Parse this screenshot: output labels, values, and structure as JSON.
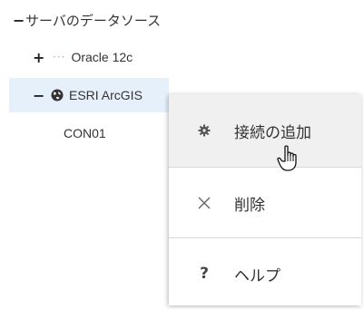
{
  "tree": {
    "root": {
      "toggle": "−",
      "label": "サーバのデータソース"
    },
    "items": [
      {
        "toggle": "+",
        "dots": "···",
        "label": "Oracle 12c"
      },
      {
        "toggle": "−",
        "icon": "globe-icon",
        "label": "ESRI ArcGIS"
      },
      {
        "label": "CON01"
      }
    ]
  },
  "context_menu": {
    "items": [
      {
        "icon": "gear-icon",
        "label": "接続の追加"
      },
      {
        "icon": "close-icon",
        "label": "削除"
      },
      {
        "icon": "help-icon",
        "glyph": "?",
        "label": "ヘルプ"
      }
    ]
  },
  "colors": {
    "selection_bg": "#e6f0fa",
    "menu_hover_bg": "#f0f0f0"
  }
}
